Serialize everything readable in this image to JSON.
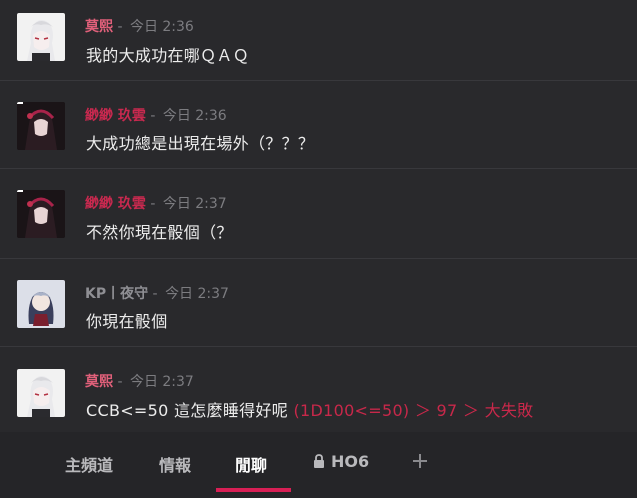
{
  "colors": {
    "background": "#29292c",
    "author_pink": "#e0607a",
    "author_crimson": "#c8294f",
    "author_gray": "#8f8f94",
    "roll_red": "#c8284a",
    "active_tab_underline": "#d81f55"
  },
  "messages": [
    {
      "author": "莫熙",
      "sep": " - ",
      "time": "今日 2:36",
      "text": "我的大成功在哪ＱＡＱ",
      "avatar": "white-hair-avatar",
      "author_color": "pink"
    },
    {
      "author": "緲緲 玖雲",
      "sep": " - ",
      "time": "今日 2:36",
      "text": "大成功總是出現在場外（？？？",
      "avatar": "dark-hair-avatar",
      "author_color": "crimson"
    },
    {
      "author": "緲緲 玖雲",
      "sep": " - ",
      "time": "今日 2:37",
      "text": "不然你現在骰個（？",
      "avatar": "dark-hair-avatar",
      "author_color": "crimson"
    },
    {
      "author": "KP丨夜守",
      "sep": " - ",
      "time": "今日 2:37",
      "text": "你現在骰個",
      "avatar": "chibi-avatar",
      "author_color": "gray"
    },
    {
      "author": "莫熙",
      "sep": " - ",
      "time": "今日 2:37",
      "text": "CCB<=50 這怎麼睡得好呢 ",
      "roll": "(1D100<=50) ＞ 97 ＞ 大失敗",
      "avatar": "white-hair-avatar",
      "author_color": "pink"
    }
  ],
  "tabs": [
    {
      "label": "主頻道",
      "active": false
    },
    {
      "label": "情報",
      "active": false
    },
    {
      "label": "閒聊",
      "active": true
    },
    {
      "label": "HO6",
      "active": false,
      "locked": true
    }
  ],
  "add_tab_icon": "plus-icon"
}
